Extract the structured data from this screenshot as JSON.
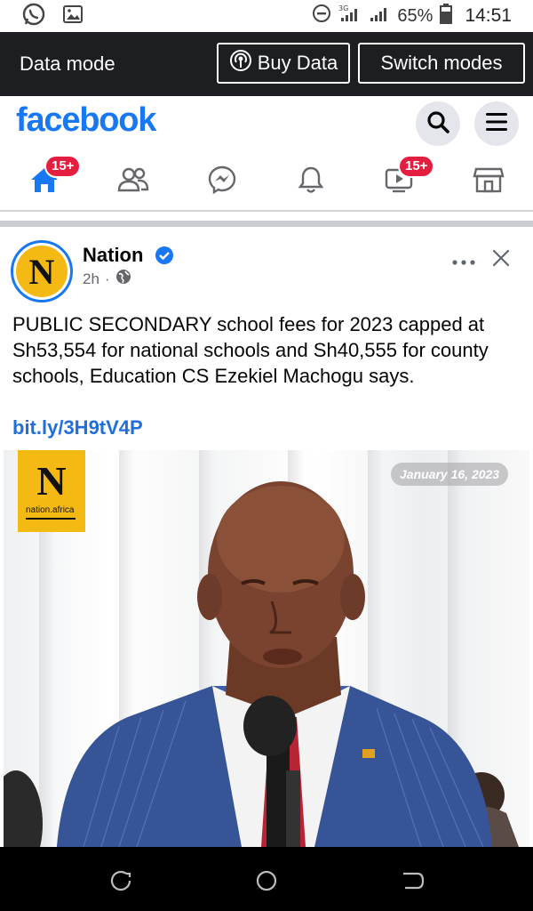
{
  "status_bar": {
    "battery_pct": "65%",
    "time": "14:51",
    "icons": [
      "whatsapp-icon",
      "gallery-icon",
      "dnd-icon",
      "signal-3g-icon",
      "signal-icon",
      "battery-icon"
    ]
  },
  "data_bar": {
    "mode_label": "Data mode",
    "buy_label": "Buy Data",
    "switch_label": "Switch modes"
  },
  "header": {
    "logo": "facebook",
    "brand_color": "#1877f2"
  },
  "nav": {
    "home_badge": "15+",
    "video_badge": "15+",
    "items": [
      "home-icon",
      "friends-icon",
      "messenger-icon",
      "bell-icon",
      "video-icon",
      "marketplace-icon"
    ]
  },
  "post": {
    "page_name": "Nation",
    "time": "2h",
    "avatar_letter": "N",
    "text": "PUBLIC SECONDARY school fees for 2023 capped at Sh53,554 for national schools and Sh40,555 for county schools, Education CS Ezekiel Machogu says.",
    "link": "bit.ly/3H9tV4P",
    "image": {
      "logo_letter": "N",
      "logo_text": "nation.africa",
      "date": "January 16, 2023"
    }
  }
}
